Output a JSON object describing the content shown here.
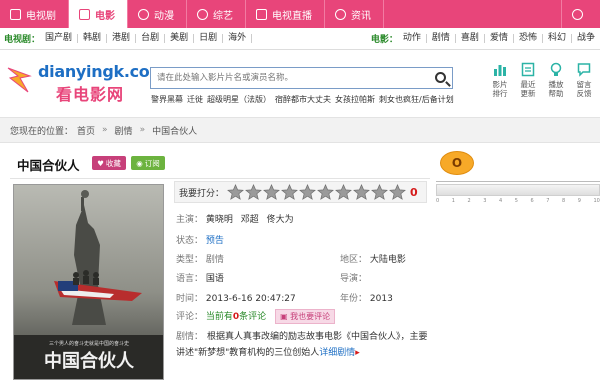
{
  "topnav": {
    "tabs": [
      {
        "label": "电视剧",
        "icon": "home-icon"
      },
      {
        "label": "电影",
        "icon": "film-icon",
        "active": true
      },
      {
        "label": "动漫",
        "icon": "anime-icon"
      },
      {
        "label": "综艺",
        "icon": "variety-icon"
      },
      {
        "label": "电视直播",
        "icon": "tv-icon"
      },
      {
        "label": "资讯",
        "icon": "news-icon"
      },
      {
        "label": "",
        "icon": "clock-icon"
      }
    ]
  },
  "catbar": {
    "tv_title": "电视剧：",
    "tv_items": [
      "国产剧",
      "韩剧",
      "港剧",
      "台剧",
      "美剧",
      "日剧",
      "海外"
    ],
    "movie_title": "电影：",
    "movie_items": [
      "动作",
      "剧情",
      "喜剧",
      "爱情",
      "恐怖",
      "科幻",
      "战争"
    ]
  },
  "header": {
    "logo_en": "dianyingk.com",
    "logo_cn": "看电影网",
    "search_placeholder": "请在此处输入影片片名或演员名称。",
    "hotwords": [
      "警界黑幕",
      "迁徙",
      "超级明星（法版）",
      "宿醉都市大丈夫",
      "女孩拉帕斯",
      "刺女也疯狂/后备计划"
    ],
    "tools": [
      {
        "label1": "影片",
        "label2": "排行",
        "icon": "bar-chart-icon"
      },
      {
        "label1": "最近",
        "label2": "更新",
        "icon": "update-icon"
      },
      {
        "label1": "播放",
        "label2": "帮助",
        "icon": "bulb-icon"
      },
      {
        "label1": "留言",
        "label2": "反馈",
        "icon": "message-icon"
      }
    ]
  },
  "breadcrumb": {
    "prefix": "您现在的位置：",
    "items": [
      "首页",
      "剧情",
      "中国合伙人"
    ]
  },
  "movie": {
    "title": "中国合伙人",
    "fav_label": "收藏",
    "sub_label": "订阅",
    "rate_label": "我要打分：",
    "rating": "0",
    "star_count": 10,
    "cast_label": "主演：",
    "cast": [
      "黄晓明",
      "邓超",
      "佟大为"
    ],
    "status_label": "状态：",
    "status": "预告",
    "type_label": "类型：",
    "type": "剧情",
    "region_label": "地区：",
    "region": "大陆电影",
    "lang_label": "语言：",
    "lang": "国语",
    "director_label": "导演：",
    "director": "",
    "time_label": "时间：",
    "time": "2013-6-16 20:47:27",
    "year_label": "年份：",
    "year": "2013",
    "comment_label": "评论：",
    "comment_pre": "当前有",
    "comment_count": "0",
    "comment_post": "条评论",
    "comment_button": "我也要评论",
    "plot_label": "剧情：",
    "plot_text": "根据真人真事改编的励志故事电影《中国合伙人》，主要讲述\"新梦想\"教育机构的三位创始人",
    "plot_link": "详细剧情",
    "poster_caption_small": "三个男人的奋斗史就是中国的奋斗史",
    "poster_title": "中国合伙人"
  },
  "side": {
    "badge": "O",
    "ticks": [
      "0",
      "1",
      "2",
      "3",
      "4",
      "5",
      "6",
      "7",
      "8",
      "9",
      "10"
    ]
  },
  "colors": {
    "pink": "#e8457a",
    "green": "#2a8a2a",
    "blue": "#1e6fc4",
    "red": "#d51a1a"
  }
}
